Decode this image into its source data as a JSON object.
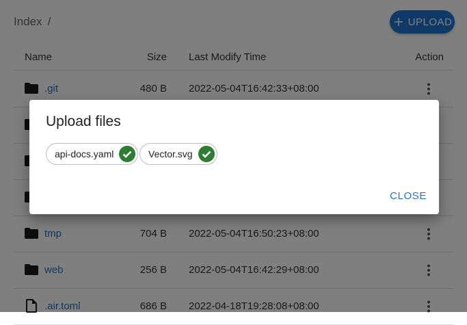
{
  "breadcrumb": {
    "root": "Index",
    "separator": "/"
  },
  "toolbar": {
    "upload_label": "UPLOAD",
    "upload_icon": "plus-icon"
  },
  "table": {
    "headers": {
      "name": "Name",
      "size": "Size",
      "time": "Last Modify Time",
      "action": "Action"
    },
    "rows": [
      {
        "type": "folder",
        "name": ".git",
        "size": "480 B",
        "time": "2022-05-04T16:42:33+08:00"
      },
      {
        "type": "folder",
        "name": "",
        "size": "",
        "time": ""
      },
      {
        "type": "folder",
        "name": "",
        "size": "",
        "time": ""
      },
      {
        "type": "folder",
        "name": "",
        "size": "",
        "time": ""
      },
      {
        "type": "folder",
        "name": "tmp",
        "size": "704 B",
        "time": "2022-05-04T16:50:23+08:00"
      },
      {
        "type": "folder",
        "name": "web",
        "size": "256 B",
        "time": "2022-05-04T16:42:29+08:00"
      },
      {
        "type": "file",
        "name": ".air.toml",
        "size": "686 B",
        "time": "2022-04-18T19:28:08+08:00"
      }
    ]
  },
  "dialog": {
    "title": "Upload files",
    "files": [
      {
        "name": "api-docs.yaml",
        "status_icon": "check-circle-icon"
      },
      {
        "name": "Vector.svg",
        "status_icon": "check-circle-icon"
      }
    ],
    "close_label": "CLOSE"
  },
  "colors": {
    "accent": "#1e74cf",
    "link": "#1f6fc2",
    "success": "#2e7d32"
  }
}
